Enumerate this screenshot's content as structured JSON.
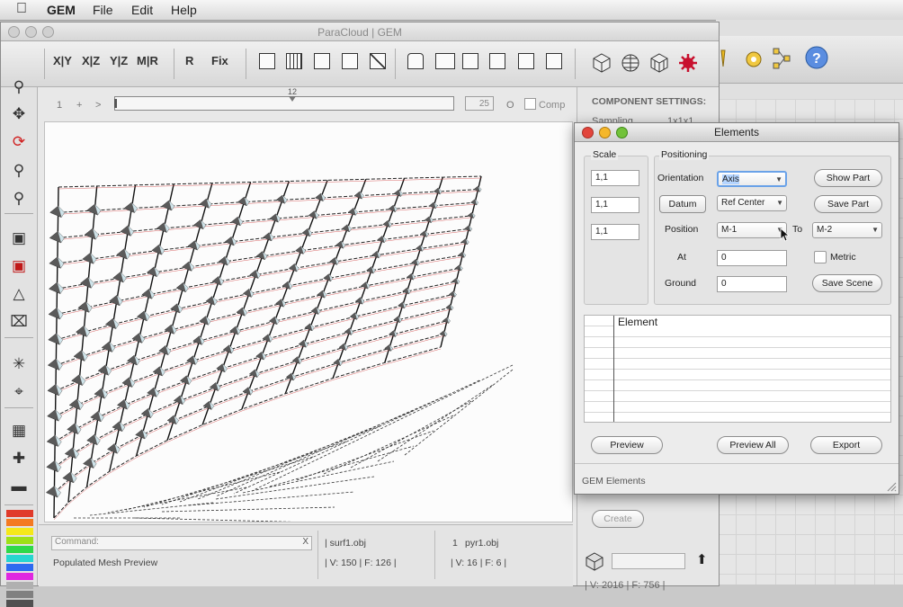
{
  "menubar": {
    "app": "GEM",
    "items": [
      "File",
      "Edit",
      "Help"
    ]
  },
  "main_window": {
    "title": "ParaCloud | GEM",
    "toolbar": {
      "view_buttons": [
        "X|Y",
        "X|Z",
        "Y|Z",
        "M|R"
      ],
      "r_label": "R",
      "fix_label": "Fix"
    },
    "slider": {
      "label_1": "1",
      "plus": "+",
      "arrow": ">",
      "thumb_value": "12",
      "value_field": "25",
      "o_label": "O",
      "comp_label": "Comp"
    },
    "component_settings": {
      "title": "COMPONENT SETTINGS:",
      "sampling_label": "Sampling",
      "sampling_value": "1x1x1",
      "create_label": "Create"
    },
    "status": {
      "command_placeholder": "Command:",
      "command_close": "X",
      "status_text": "Populated Mesh Preview",
      "file1": "| surf1.obj",
      "file1_stats": "| V: 150 | F: 126 |",
      "file2_index": "1",
      "file2": "pyr1.obj",
      "file2_stats": "| V: 16 | F: 6 |",
      "total_stats": "| V: 2016 | F: 756 |"
    }
  },
  "elements_dialog": {
    "title": "Elements",
    "scale": {
      "title": "Scale",
      "values": [
        "1,1",
        "1,1",
        "1,1"
      ]
    },
    "positioning": {
      "title": "Positioning",
      "orientation_label": "Orientation",
      "orientation_value": "Axis",
      "datum_label": "Datum",
      "datum_value": "Ref Center",
      "position_label": "Position",
      "position_value": "M-1",
      "to_label": "To",
      "to_value": "M-2",
      "at_label": "At",
      "at_value": "0",
      "ground_label": "Ground",
      "ground_value": "0",
      "metric_label": "Metric"
    },
    "buttons": {
      "show_part": "Show Part",
      "save_part": "Save Part",
      "save_scene": "Save Scene",
      "preview": "Preview",
      "preview_all": "Preview All",
      "export": "Export"
    },
    "list": {
      "column_header": "Element"
    },
    "footer": "GEM Elements"
  },
  "colors": {
    "palette": [
      "#e03a2a",
      "#f47a22",
      "#f5e81a",
      "#9ee017",
      "#2fd94a",
      "#27d6d0",
      "#2e6af0",
      "#e028e0",
      "#b0b0b0",
      "#808080",
      "#505050"
    ],
    "close_light": "#e2453c",
    "minimize_light": "#f5b72a",
    "zoom_light": "#72c23a",
    "accent_selection": "#b5d5ff"
  }
}
